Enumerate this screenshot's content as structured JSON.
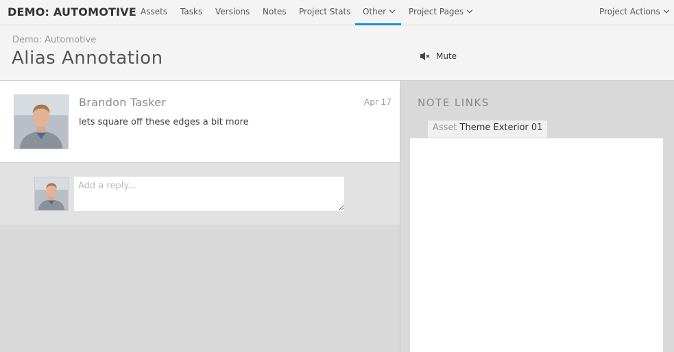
{
  "nav": {
    "brand": "DEMO: AUTOMOTIVE",
    "items": [
      "Assets",
      "Tasks",
      "Versions",
      "Notes",
      "Project Stats"
    ],
    "other": "Other",
    "project_pages": "Project Pages",
    "project_actions": "Project Actions"
  },
  "header": {
    "breadcrumb": "Demo: Automotive",
    "title": "Alias Annotation",
    "mute_label": "Mute"
  },
  "note": {
    "author": "Brandon Tasker",
    "date": "Apr 17",
    "text": "lets square off these edges a bit more"
  },
  "reply": {
    "placeholder": "Add a reply..."
  },
  "note_links": {
    "title": "NOTE LINKS",
    "link_type": "Asset",
    "link_name": "Theme Exterior 01"
  },
  "colors": {
    "accent": "#1a8fd1"
  }
}
